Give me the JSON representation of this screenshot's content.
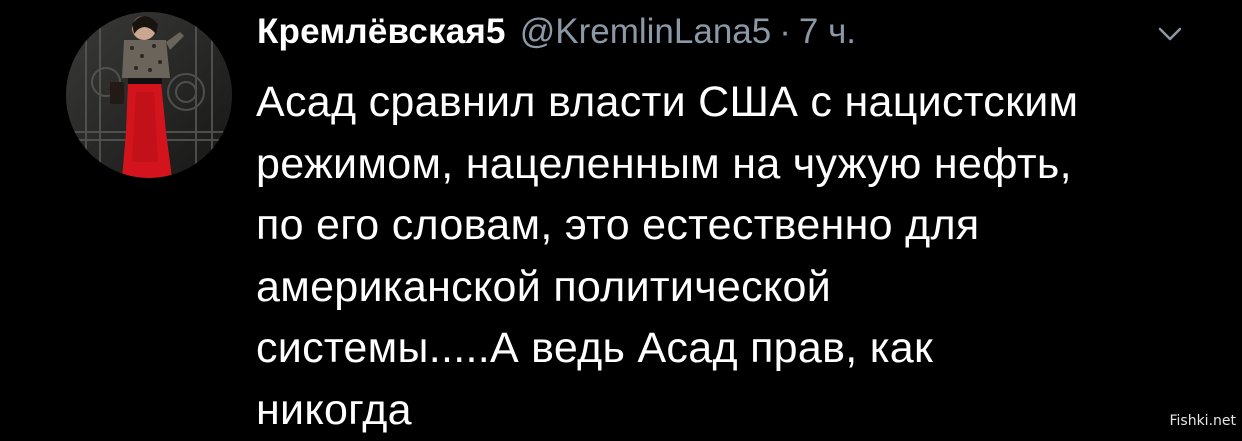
{
  "tweet": {
    "author": {
      "display_name": "Кремлёвская5",
      "handle": "@KremlinLana5",
      "separator": "·",
      "timestamp": "7 ч."
    },
    "menu_icon": "chevron-down-icon",
    "text_lines": [
      "Асад сравнил власти США с нацистским",
      "режимом, нацеленным на чужую нефть,",
      "по его словам, это естественно для",
      "американской политической",
      "системы.....А ведь Асад прав, как",
      "никогда"
    ]
  },
  "watermark": "Fishki.net",
  "colors": {
    "background": "#000000",
    "text": "#ffffff",
    "secondary": "#8b98a5",
    "accent_dress": "#d4141c"
  }
}
